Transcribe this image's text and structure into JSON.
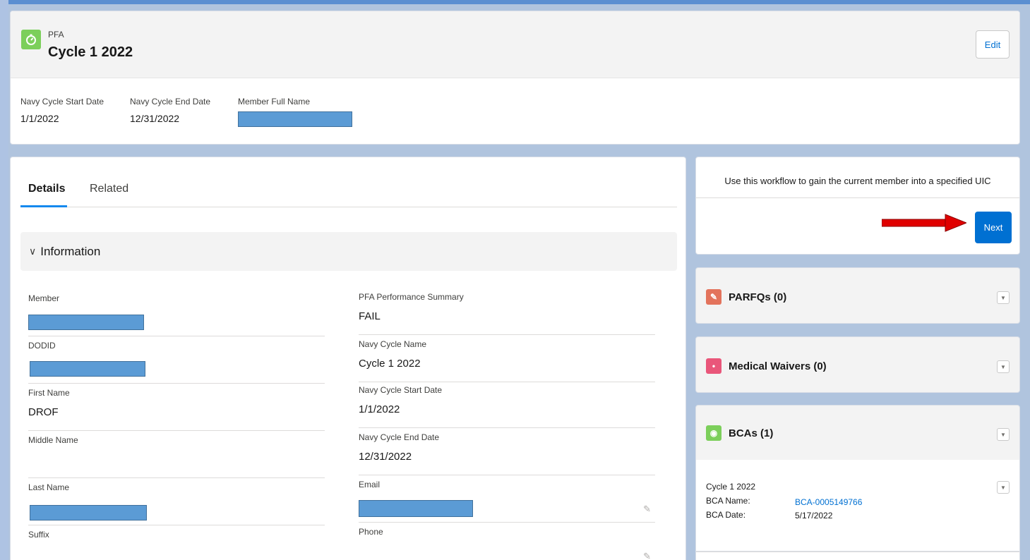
{
  "header": {
    "object_type": "PFA",
    "title": "Cycle 1 2022",
    "edit_label": "Edit",
    "fields": [
      {
        "label": "Navy Cycle Start Date",
        "value": "1/1/2022"
      },
      {
        "label": "Navy Cycle End Date",
        "value": "12/31/2022"
      },
      {
        "label": "Member Full Name",
        "value": ""
      }
    ]
  },
  "tabs": {
    "details": "Details",
    "related": "Related"
  },
  "section": {
    "title": "Information",
    "chevron": "chevron-down-icon"
  },
  "left_fields": [
    {
      "label": "Member",
      "value": ""
    },
    {
      "label": "DODID",
      "value": ""
    },
    {
      "label": "First Name",
      "value": "DROF"
    },
    {
      "label": "Middle Name",
      "value": ""
    },
    {
      "label": "Last Name",
      "value": ""
    },
    {
      "label": "Suffix",
      "value": ""
    }
  ],
  "right_fields": [
    {
      "label": "PFA Performance Summary",
      "value": "FAIL"
    },
    {
      "label": "Navy Cycle Name",
      "value": "Cycle 1 2022"
    },
    {
      "label": "Navy Cycle Start Date",
      "value": "1/1/2022"
    },
    {
      "label": "Navy Cycle End Date",
      "value": "12/31/2022"
    },
    {
      "label": "Email",
      "value": ""
    },
    {
      "label": "Phone",
      "value": ""
    }
  ],
  "flow": {
    "text": "Use this workflow to gain the current member into a specified UIC",
    "next_label": "Next"
  },
  "related": [
    {
      "title": "PARFQs (0)",
      "color": "#e3735c"
    },
    {
      "title": "Medical Waivers (0)",
      "color": "#e9567a"
    },
    {
      "title": "BCAs (1)",
      "color": "#7ccf5b"
    }
  ],
  "bca_record": {
    "cycle": "Cycle 1 2022",
    "name_label": "BCA Name:",
    "name_value": "BCA-0005149766",
    "date_label": "BCA Date:",
    "date_value": "5/17/2022"
  },
  "colors": {
    "brand_blue": "#0070d2",
    "redaction": "#5b9bd5",
    "arrow_red": "#e00000"
  }
}
